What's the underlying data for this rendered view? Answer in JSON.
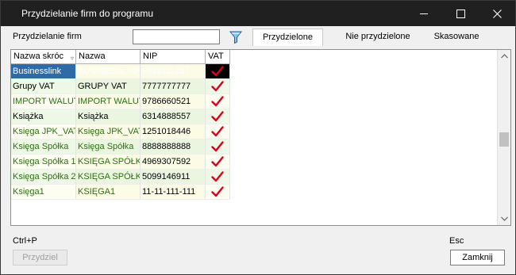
{
  "window": {
    "title": "Przydzielanie firm do programu"
  },
  "filter": {
    "label": "Przydzielanie firm",
    "value": ""
  },
  "tabs": [
    {
      "label": "Przydzielone",
      "active": true
    },
    {
      "label": "Nie przydzielone",
      "active": false
    },
    {
      "label": "Skasowane",
      "active": false
    }
  ],
  "table": {
    "columns": [
      "Nazwa skróc",
      "Nazwa",
      "NIP",
      "VAT"
    ],
    "rows": [
      {
        "short": "Businesslink",
        "name": "BUSINESSLINK",
        "nip": "6019111237",
        "vat": true,
        "selected": true
      },
      {
        "short": "Grupy VAT",
        "name": "GRUPY VAT",
        "nip": "7777777777",
        "vat": true
      },
      {
        "short": "IMPORT WALUTOWY",
        "name": "IMPORT WALUTOWY",
        "nip": "9786660521",
        "vat": true
      },
      {
        "short": "Książka",
        "name": "Książka",
        "nip": "6314888557",
        "vat": true
      },
      {
        "short": "Księga JPK_VAT",
        "name": "Księga JPK_VAT",
        "nip": "1251018446",
        "vat": true
      },
      {
        "short": "Księga Spółka",
        "name": "Księga Spółka",
        "nip": "8888888888",
        "vat": true
      },
      {
        "short": "Księga Spółka 1",
        "name": "KSIĘGA SPÓŁKA",
        "nip": "4969307592",
        "vat": true
      },
      {
        "short": "Księga Spółka 2",
        "name": "KSIĘGA SPÓŁKA",
        "nip": "5099146911",
        "vat": true
      },
      {
        "short": "Księga1",
        "name": "KSIĘGA1",
        "nip": "11-11-111-111",
        "vat": true
      }
    ]
  },
  "footer": {
    "shortcut_left": "Ctrl+P",
    "assign_label": "Przydziel",
    "shortcut_right": "Esc",
    "close_label": "Zamknij"
  },
  "colors": {
    "selected_row": "#000000",
    "selected_cell": "#2f6aa8",
    "check": "#d9001b",
    "titlebar": "#202020"
  }
}
